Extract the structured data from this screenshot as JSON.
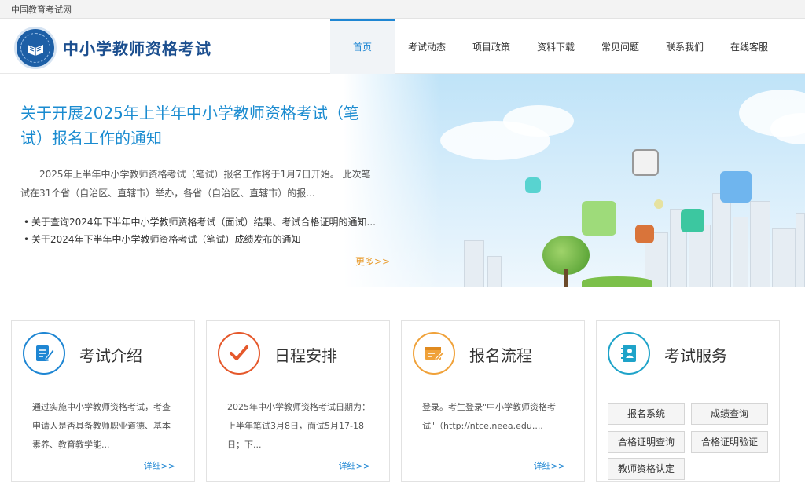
{
  "topbar": {
    "site_link": "中国教育考试网"
  },
  "header": {
    "title": "中小学教师资格考试"
  },
  "nav": {
    "items": [
      {
        "label": "首页",
        "active": true
      },
      {
        "label": "考试动态"
      },
      {
        "label": "项目政策"
      },
      {
        "label": "资料下载"
      },
      {
        "label": "常见问题"
      },
      {
        "label": "联系我们"
      },
      {
        "label": "在线客服"
      }
    ]
  },
  "banner": {
    "title": "关于开展2025年上半年中小学教师资格考试（笔试）报名工作的通知",
    "summary": "2025年上半年中小学教师资格考试（笔试）报名工作将于1月7日开始。   此次笔试在31个省（自治区、直辖市）举办，各省（自治区、直辖市）的报...",
    "links": [
      "关于查询2024年下半年中小学教师资格考试（面试）结果、考试合格证明的通知...",
      "关于2024年下半年中小学教师资格考试（笔试）成绩发布的通知"
    ],
    "more": "更多>>"
  },
  "cards": [
    {
      "title": "考试介绍",
      "icon": "document-pen-icon",
      "color": "#1e86d3",
      "desc": "通过实施中小学教师资格考试，考查申请人是否具备教师职业道德、基本素养、教育教学能...",
      "detail": "详细>>"
    },
    {
      "title": "日程安排",
      "icon": "checkmark-icon",
      "color": "#e5582b",
      "desc": "2025年中小学教师资格考试日期为：上半年笔试3月8日，面试5月17-18日；下...",
      "detail": "详细>>"
    },
    {
      "title": "报名流程",
      "icon": "form-pen-icon",
      "color": "#f0a23a",
      "desc": "登录。考生登录\"中小学教师资格考试\"（http://ntce.neea.edu....",
      "detail": "详细>>"
    },
    {
      "title": "考试服务",
      "icon": "address-book-icon",
      "color": "#1ea3c9",
      "buttons": [
        "报名系统",
        "成绩查询",
        "合格证明查询",
        "合格证明验证",
        "教师资格认定"
      ]
    }
  ]
}
